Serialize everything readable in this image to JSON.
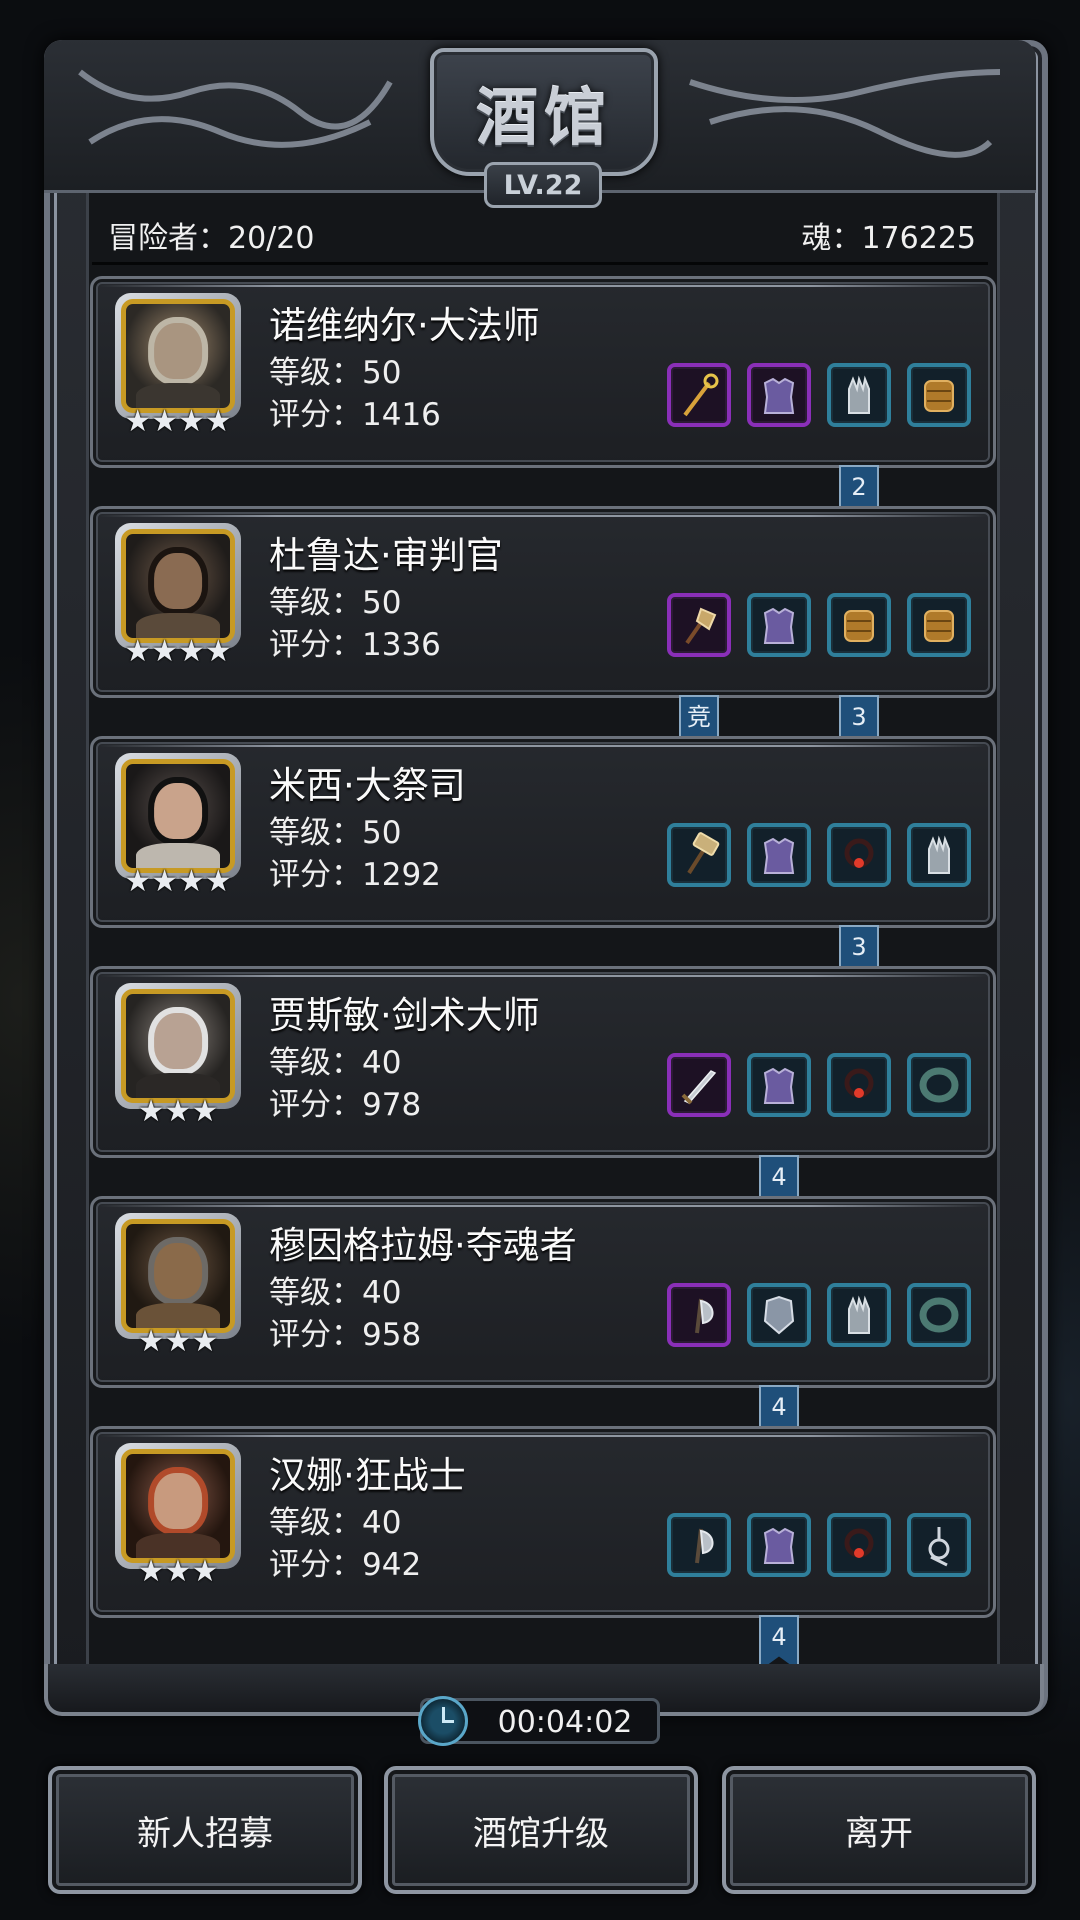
{
  "header": {
    "title": "酒馆",
    "level": "LV.22"
  },
  "stats": {
    "adventurers": "冒险者：20/20",
    "souls": "魂：176225"
  },
  "heroes": [
    {
      "name": "诺维纳尔·大法师",
      "level": "等级：50",
      "score": "评分：1416",
      "stars": "★★★★",
      "equips": [
        {
          "icon": "staff-icon",
          "rarity": "purple"
        },
        {
          "icon": "armor-icon",
          "rarity": "purple"
        },
        {
          "icon": "gauntlet-icon",
          "rarity": "teal"
        },
        {
          "icon": "boots-icon",
          "rarity": "teal"
        }
      ],
      "tags": [
        {
          "text": "2",
          "slot": 2
        }
      ]
    },
    {
      "name": "杜鲁达·审判官",
      "level": "等级：50",
      "score": "评分：1336",
      "stars": "★★★★",
      "equips": [
        {
          "icon": "mace-icon",
          "rarity": "purple"
        },
        {
          "icon": "armor-icon",
          "rarity": "teal"
        },
        {
          "icon": "boots-icon",
          "rarity": "teal"
        },
        {
          "icon": "boots-icon",
          "rarity": "teal"
        }
      ],
      "tags": [
        {
          "text": "竞",
          "slot": 0
        },
        {
          "text": "3",
          "slot": 2
        }
      ]
    },
    {
      "name": "米西·大祭司",
      "level": "等级：50",
      "score": "评分：1292",
      "stars": "★★★★",
      "equips": [
        {
          "icon": "hammer-icon",
          "rarity": "teal"
        },
        {
          "icon": "armor-icon",
          "rarity": "teal"
        },
        {
          "icon": "necklace-icon",
          "rarity": "teal"
        },
        {
          "icon": "gauntlet-icon",
          "rarity": "teal"
        }
      ],
      "tags": [
        {
          "text": "3",
          "slot": 2
        }
      ]
    },
    {
      "name": "贾斯敏·剑术大师",
      "level": "等级：40",
      "score": "评分：978",
      "stars": "★★★",
      "equips": [
        {
          "icon": "sword-icon",
          "rarity": "purple"
        },
        {
          "icon": "armor-icon",
          "rarity": "teal"
        },
        {
          "icon": "necklace-icon",
          "rarity": "teal"
        },
        {
          "icon": "ring-icon",
          "rarity": "teal"
        }
      ],
      "tags": [
        {
          "text": "4",
          "slot": 1
        }
      ]
    },
    {
      "name": "穆因格拉姆·夺魂者",
      "level": "等级：40",
      "score": "评分：958",
      "stars": "★★★",
      "equips": [
        {
          "icon": "axe-icon",
          "rarity": "purple"
        },
        {
          "icon": "chestplate-icon",
          "rarity": "teal"
        },
        {
          "icon": "gauntlet-icon",
          "rarity": "teal"
        },
        {
          "icon": "ring-icon",
          "rarity": "teal"
        }
      ],
      "tags": [
        {
          "text": "4",
          "slot": 1
        }
      ]
    },
    {
      "name": "汉娜·狂战士",
      "level": "等级：40",
      "score": "评分：942",
      "stars": "★★★",
      "equips": [
        {
          "icon": "axe-icon",
          "rarity": "teal"
        },
        {
          "icon": "armor-icon",
          "rarity": "teal"
        },
        {
          "icon": "necklace-icon",
          "rarity": "teal"
        },
        {
          "icon": "amulet-icon",
          "rarity": "teal"
        }
      ],
      "tags": [
        {
          "text": "4",
          "slot": 1
        }
      ]
    }
  ],
  "timer": "00:04:02",
  "buttons": {
    "recruit": "新人招募",
    "upgrade": "酒馆升级",
    "leave": "离开"
  },
  "colors": {
    "gold_frame": "#c79a24",
    "purple_rarity": "#8a2fb8",
    "teal_rarity": "#2f7f9b",
    "tag_blue": "#1f4f7a"
  }
}
